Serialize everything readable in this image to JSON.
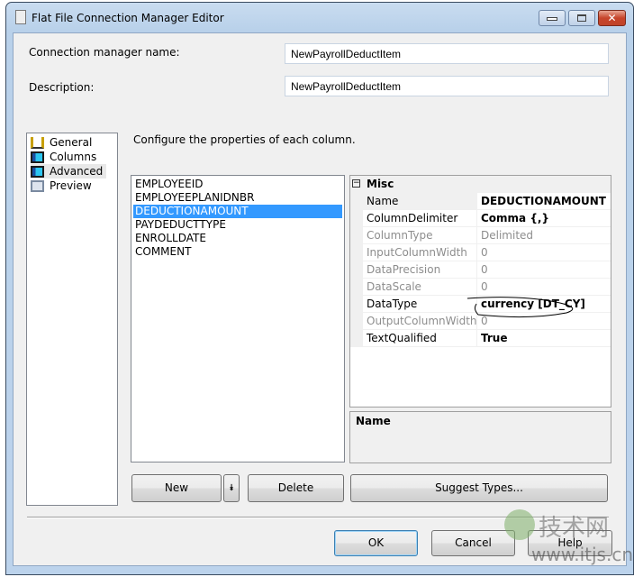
{
  "window": {
    "title": "Flat File Connection Manager Editor"
  },
  "fields": {
    "connection_name_label": "Connection manager name:",
    "connection_name_value": "NewPayrollDeductItem",
    "description_label": "Description:",
    "description_value": "NewPayrollDeductItem"
  },
  "nav": {
    "items": [
      {
        "label": "General",
        "icon": "general-icon"
      },
      {
        "label": "Columns",
        "icon": "columns-icon"
      },
      {
        "label": "Advanced",
        "icon": "advanced-icon",
        "selected": true
      },
      {
        "label": "Preview",
        "icon": "preview-icon"
      }
    ]
  },
  "main": {
    "instruction": "Configure the properties of each column.",
    "columns": [
      "EMPLOYEEID",
      "EMPLOYEEPLANIDNBR",
      "DEDUCTIONAMOUNT",
      "PAYDEDUCTTYPE",
      "ENROLLDATE",
      "COMMENT"
    ],
    "selected_column": "DEDUCTIONAMOUNT",
    "properties": {
      "category": "Misc",
      "rows": [
        {
          "name": "Name",
          "value": "DEDUCTIONAMOUNT",
          "enabled": true,
          "bold": true
        },
        {
          "name": "ColumnDelimiter",
          "value": "Comma {,}",
          "enabled": true,
          "bold": true
        },
        {
          "name": "ColumnType",
          "value": "Delimited",
          "enabled": false
        },
        {
          "name": "InputColumnWidth",
          "value": "0",
          "enabled": false
        },
        {
          "name": "DataPrecision",
          "value": "0",
          "enabled": false
        },
        {
          "name": "DataScale",
          "value": "0",
          "enabled": false
        },
        {
          "name": "DataType",
          "value": "currency [DT_CY]",
          "enabled": true,
          "bold": true
        },
        {
          "name": "OutputColumnWidth",
          "value": "0",
          "enabled": false
        },
        {
          "name": "TextQualified",
          "value": "True",
          "enabled": true,
          "bold": true
        }
      ]
    },
    "description_title": "Name",
    "buttons": {
      "new": "New",
      "delete": "Delete",
      "suggest": "Suggest Types..."
    }
  },
  "footer": {
    "ok": "OK",
    "cancel": "Cancel",
    "help": "Help"
  },
  "watermark": {
    "logo": "IT技术网",
    "url": "www.itjs.cn"
  }
}
